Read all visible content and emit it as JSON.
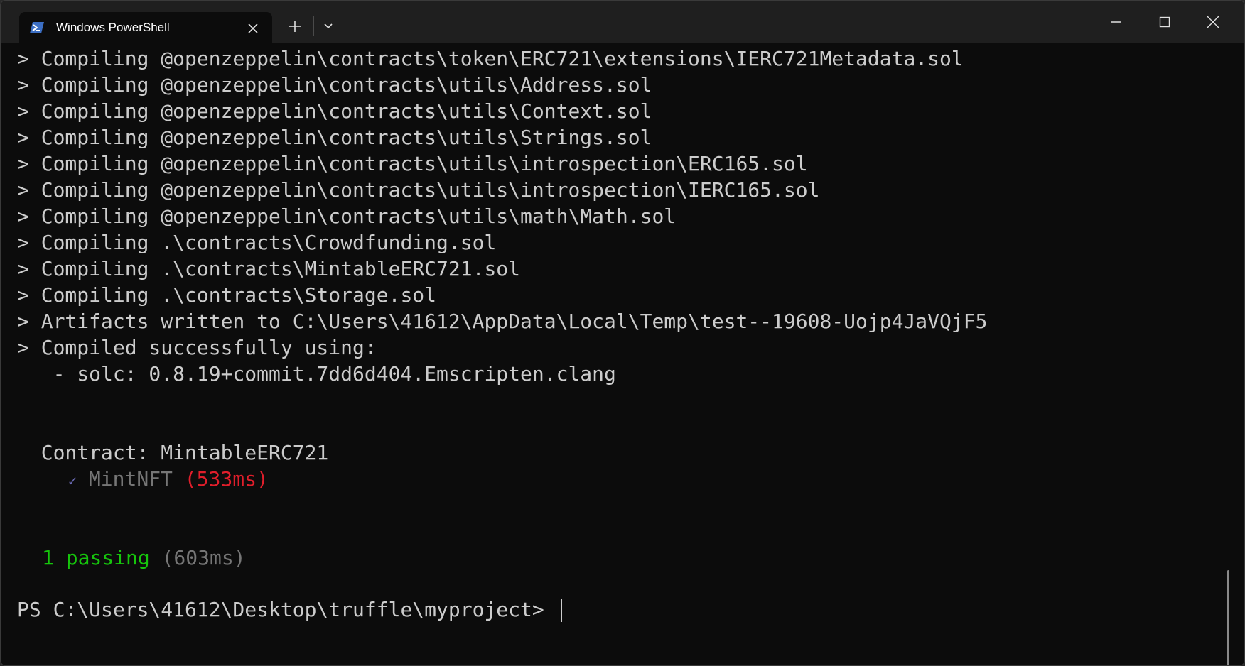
{
  "window": {
    "tab_title": "Windows PowerShell",
    "icon": "powershell-icon"
  },
  "terminal": {
    "lines": [
      "> Compiling @openzeppelin\\contracts\\token\\ERC721\\extensions\\IERC721Metadata.sol",
      "> Compiling @openzeppelin\\contracts\\utils\\Address.sol",
      "> Compiling @openzeppelin\\contracts\\utils\\Context.sol",
      "> Compiling @openzeppelin\\contracts\\utils\\Strings.sol",
      "> Compiling @openzeppelin\\contracts\\utils\\introspection\\ERC165.sol",
      "> Compiling @openzeppelin\\contracts\\utils\\introspection\\IERC165.sol",
      "> Compiling @openzeppelin\\contracts\\utils\\math\\Math.sol",
      "> Compiling .\\contracts\\Crowdfunding.sol",
      "> Compiling .\\contracts\\MintableERC721.sol",
      "> Compiling .\\contracts\\Storage.sol",
      "> Artifacts written to C:\\Users\\41612\\AppData\\Local\\Temp\\test--19608-Uojp4JaVQjF5",
      "> Compiled successfully using:",
      "   - solc: 0.8.19+commit.7dd6d404.Emscripten.clang"
    ],
    "contract_line": "  Contract: MintableERC721",
    "test": {
      "check": "✓",
      "name": "MintNFT",
      "duration": "(533ms)"
    },
    "summary": {
      "count": "1 passing",
      "duration": "(603ms)"
    },
    "prompt": "PS C:\\Users\\41612\\Desktop\\truffle\\myproject> "
  },
  "colors": {
    "background": "#0c0c0c",
    "text": "#cccccc",
    "passing": "#16c60c",
    "slow": "#e01e2b",
    "dim": "#767676"
  }
}
